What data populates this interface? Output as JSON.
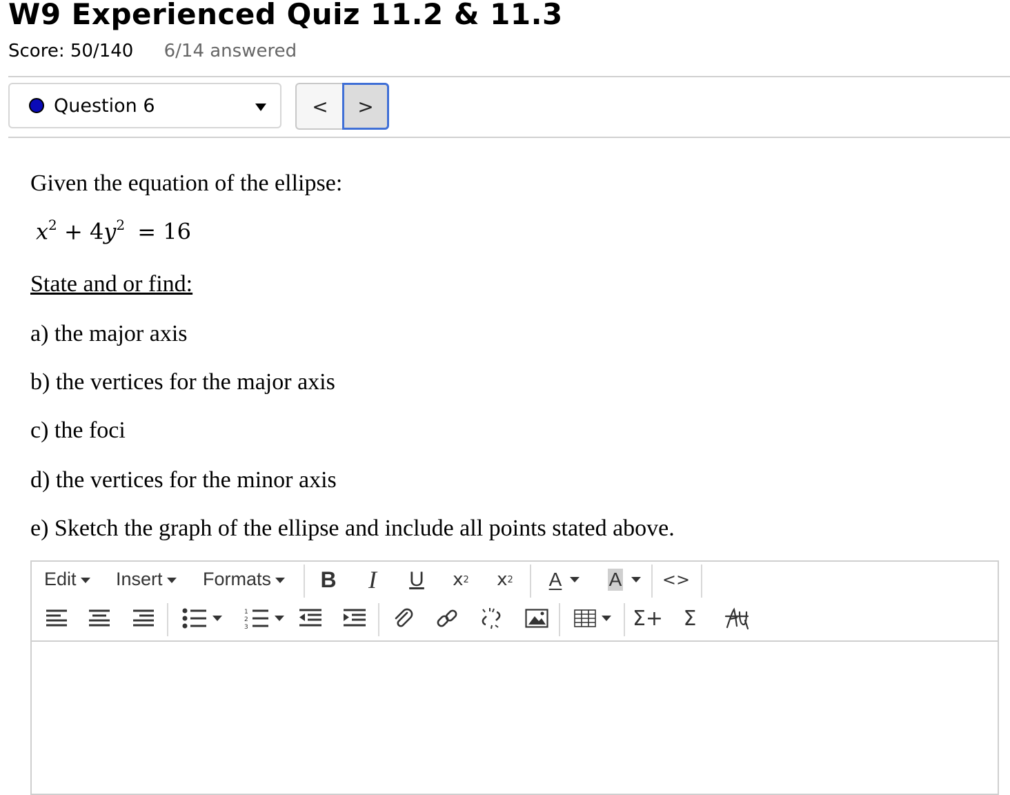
{
  "header": {
    "title": "W9 Experienced Quiz 11.2 & 11.3",
    "score": "Score: 50/140",
    "answered": "6/14 answered"
  },
  "nav": {
    "question_label": "Question 6",
    "prev": "<",
    "next": ">",
    "status_dot_color": "#0a0ab8",
    "active_border_color": "#3f6fd6"
  },
  "question": {
    "intro": "Given the equation of the ellipse:",
    "equation": {
      "x": "x",
      "x_exp": "2",
      "plus": "+",
      "coef": "4",
      "y": "y",
      "y_exp": "2",
      "equals": "=",
      "rhs": "16"
    },
    "instruction": "State and or find:",
    "parts": [
      "a) the major axis",
      "b) the vertices for the major axis",
      "c) the foci",
      "d) the vertices for the minor axis",
      "e) Sketch the graph of the ellipse and include all points stated above."
    ]
  },
  "editor": {
    "menus": {
      "edit": "Edit",
      "insert": "Insert",
      "formats": "Formats"
    },
    "buttons": {
      "bold": "B",
      "italic": "I",
      "underline": "U",
      "subscript": "x",
      "subscript_mark": "2",
      "superscript": "x",
      "superscript_mark": "2",
      "font_color": "A",
      "bg_color": "A",
      "code": "<>",
      "sum_plus": "Σ+",
      "sum": "Σ"
    },
    "icons": [
      "align-left-icon",
      "align-center-icon",
      "align-right-icon",
      "bullet-list-icon",
      "numbered-list-icon",
      "outdent-icon",
      "indent-icon",
      "attachment-icon",
      "link-icon",
      "unlink-icon",
      "image-icon",
      "table-icon",
      "math-sigma-plus-icon",
      "math-sigma-icon",
      "strikethrough-script-icon"
    ],
    "content": ""
  }
}
